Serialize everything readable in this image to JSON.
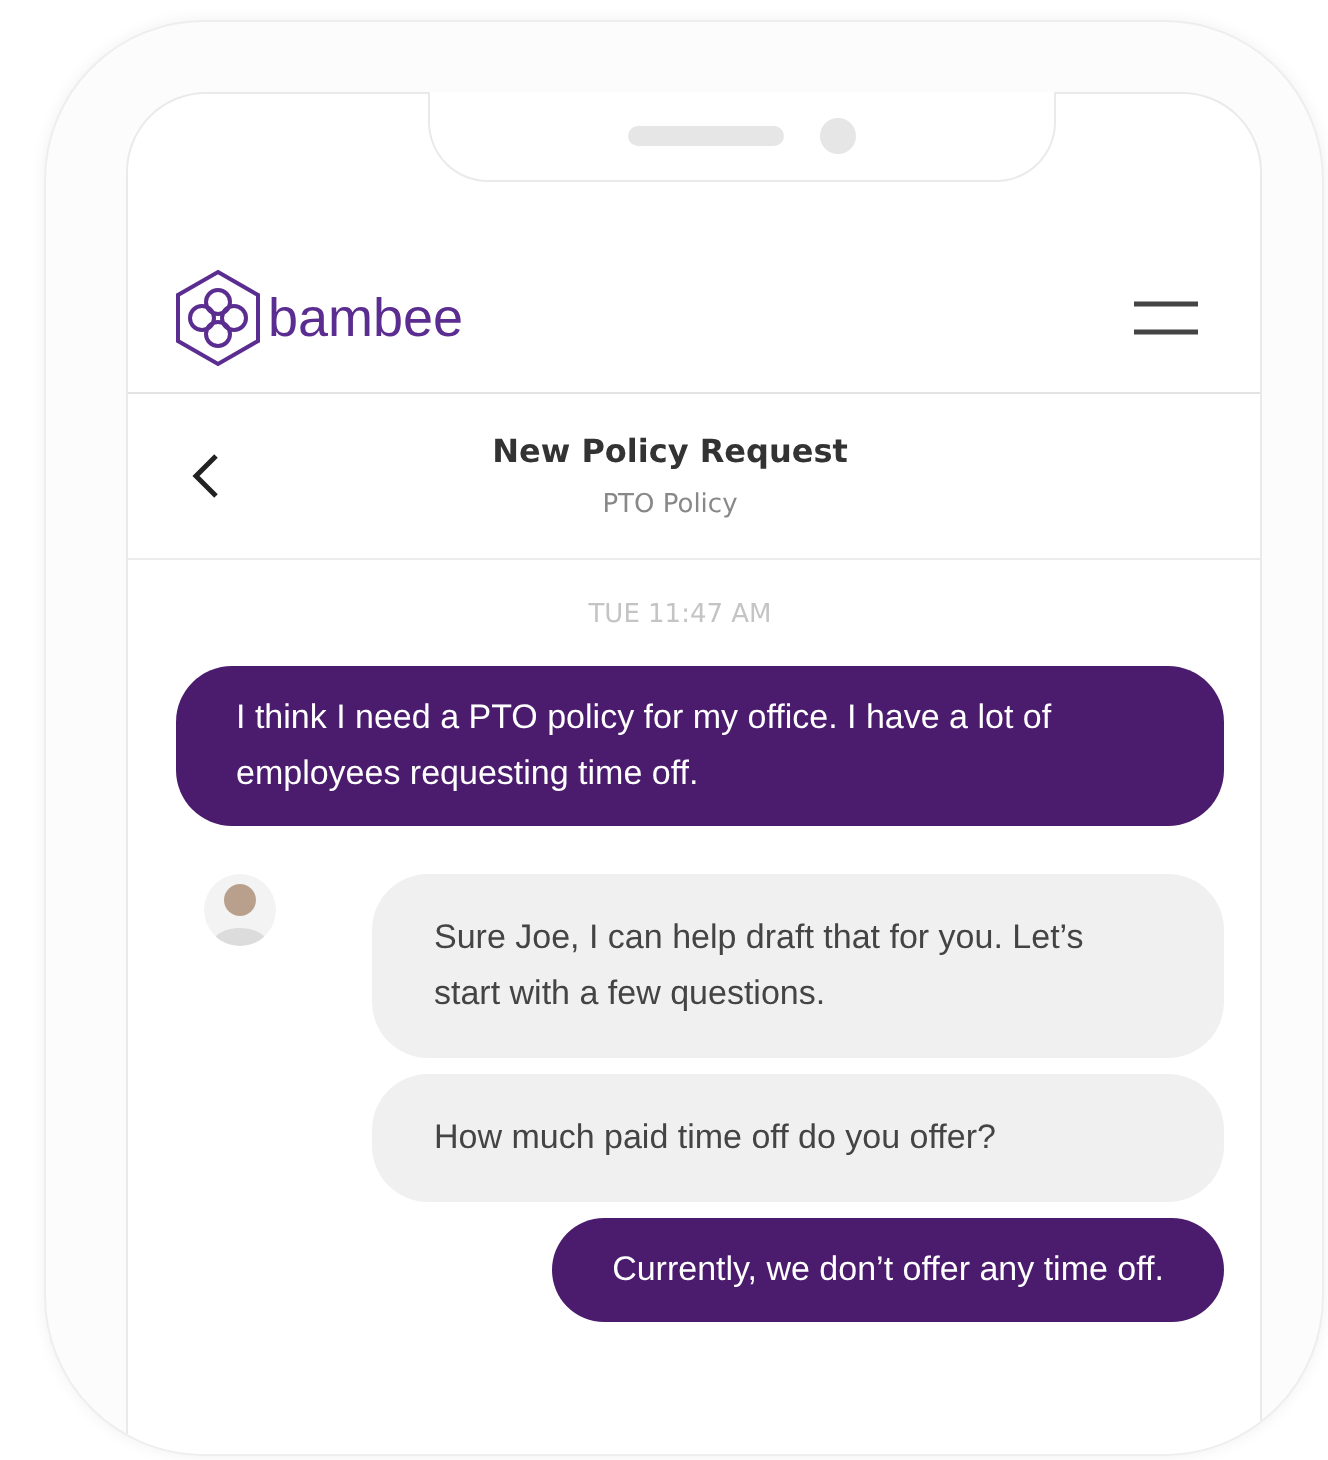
{
  "header": {
    "logo_text": "bambee"
  },
  "conversation": {
    "title": "New Policy Request",
    "subtitle": "PTO Policy"
  },
  "timestamp": "TUE 11:47 AM",
  "messages": [
    {
      "kind": "sent",
      "text": "I think I need a PTO policy for my office. I have a lot of employees requesting time off."
    },
    {
      "kind": "received",
      "text": "Sure Joe, I can help draft that for you. Let’s start with a few questions.",
      "avatar": true
    },
    {
      "kind": "received",
      "text": "How much paid time off do you offer?",
      "avatar": false
    },
    {
      "kind": "sent",
      "text": "Currently, we don’t offer any time off."
    }
  ]
}
